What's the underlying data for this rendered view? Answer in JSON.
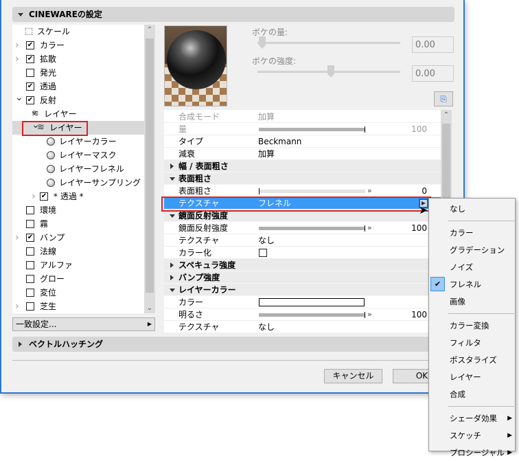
{
  "section_title": "CINEWAREの設定",
  "tree": [
    {
      "label": "スケール",
      "checkbox": null,
      "indent": 0,
      "chev": "",
      "icon": "scale"
    },
    {
      "label": "カラー",
      "checkbox": true,
      "indent": 0,
      "chev": ">"
    },
    {
      "label": "拡散",
      "checkbox": true,
      "indent": 0,
      "chev": ">"
    },
    {
      "label": "発光",
      "checkbox": false,
      "indent": 0,
      "chev": ""
    },
    {
      "label": "透過",
      "checkbox": true,
      "indent": 0,
      "chev": ""
    },
    {
      "label": "反射",
      "checkbox": true,
      "indent": 0,
      "chev": "v"
    },
    {
      "label": "レイヤー",
      "checkbox": null,
      "indent": 1,
      "chev": "v",
      "icon": "layers"
    },
    {
      "label": "レイヤー",
      "checkbox": null,
      "indent": 2,
      "chev": "v",
      "icon": "layers",
      "selected": true
    },
    {
      "label": "レイヤーカラー",
      "checkbox": null,
      "indent": 3,
      "icon": "sphere"
    },
    {
      "label": "レイヤーマスク",
      "checkbox": null,
      "indent": 3,
      "icon": "sphere"
    },
    {
      "label": "レイヤーフレネル",
      "checkbox": null,
      "indent": 3,
      "icon": "sphere"
    },
    {
      "label": "レイヤーサンプリング",
      "checkbox": null,
      "indent": 3,
      "icon": "sphere"
    },
    {
      "label": "* 透過 *",
      "checkbox": true,
      "indent": 2,
      "chev": ">"
    },
    {
      "label": "環境",
      "checkbox": false,
      "indent": 0,
      "chev": ""
    },
    {
      "label": "霧",
      "checkbox": false,
      "indent": 0,
      "chev": ""
    },
    {
      "label": "バンプ",
      "checkbox": true,
      "indent": 0,
      "chev": ">"
    },
    {
      "label": "法線",
      "checkbox": false,
      "indent": 0,
      "chev": ""
    },
    {
      "label": "アルファ",
      "checkbox": false,
      "indent": 0,
      "chev": ""
    },
    {
      "label": "グロー",
      "checkbox": false,
      "indent": 0,
      "chev": ""
    },
    {
      "label": "変位",
      "checkbox": false,
      "indent": 0,
      "chev": ""
    },
    {
      "label": "芝生",
      "checkbox": false,
      "indent": 0,
      "chev": ">"
    }
  ],
  "match_button": "一致設定...",
  "bokeh": {
    "amount_label": "ボケの量:",
    "amount_value": "0.00",
    "amount_slider": 0,
    "strength_label": "ボケの強度:",
    "strength_value": "0.00",
    "strength_slider": 0.5
  },
  "props": [
    {
      "type": "row",
      "label": "合成モード",
      "value": "加算",
      "dim": true
    },
    {
      "type": "slider",
      "label": "量",
      "number": "100",
      "fill": 1,
      "dim": true
    },
    {
      "type": "row",
      "label": "タイプ",
      "value": "Beckmann"
    },
    {
      "type": "row",
      "label": "減衰",
      "value": "加算"
    },
    {
      "type": "group",
      "label": "幅 / 表面粗さ",
      "open": false
    },
    {
      "type": "group",
      "label": "表面粗さ",
      "open": true
    },
    {
      "type": "slider",
      "label": "表面粗さ",
      "number": "0",
      "fill": 0
    },
    {
      "type": "row",
      "label": "テクスチャ",
      "value": "フレネル",
      "highlight": true
    },
    {
      "type": "group",
      "label": "鏡面反射強度",
      "open": true
    },
    {
      "type": "slider",
      "label": "鏡面反射強度",
      "number": "100",
      "fill": 1
    },
    {
      "type": "row",
      "label": "テクスチャ",
      "value": "なし"
    },
    {
      "type": "check",
      "label": "カラー化",
      "checked": false
    },
    {
      "type": "group",
      "label": "スペキュラ強度",
      "open": false
    },
    {
      "type": "group",
      "label": "バンプ強度",
      "open": false
    },
    {
      "type": "group",
      "label": "レイヤーカラー",
      "open": true
    },
    {
      "type": "color",
      "label": "カラー",
      "color": "#ffffff"
    },
    {
      "type": "slider",
      "label": "明るさ",
      "number": "100",
      "fill": 1
    },
    {
      "type": "row",
      "label": "テクスチャ",
      "value": "なし"
    }
  ],
  "vector_hatching": "ベクトルハッチング",
  "buttons": {
    "cancel": "キャンセル",
    "ok": "OK"
  },
  "menu": [
    {
      "label": "なし"
    },
    {
      "sep": true
    },
    {
      "label": "カラー"
    },
    {
      "label": "グラデーション"
    },
    {
      "label": "ノイズ"
    },
    {
      "label": "フレネル",
      "checked": true
    },
    {
      "label": "画像"
    },
    {
      "sep": true
    },
    {
      "label": "カラー変換"
    },
    {
      "label": "フィルタ"
    },
    {
      "label": "ポスタライズ"
    },
    {
      "label": "レイヤー"
    },
    {
      "label": "合成"
    },
    {
      "sep": true
    },
    {
      "label": "シェーダ効果",
      "submenu": true
    },
    {
      "label": "スケッチ",
      "submenu": true
    },
    {
      "label": "プロシージャル",
      "submenu": true
    }
  ],
  "colors": {
    "highlight": "#3c9af7",
    "annotation": "#e02020",
    "border": "#2b78d0"
  }
}
